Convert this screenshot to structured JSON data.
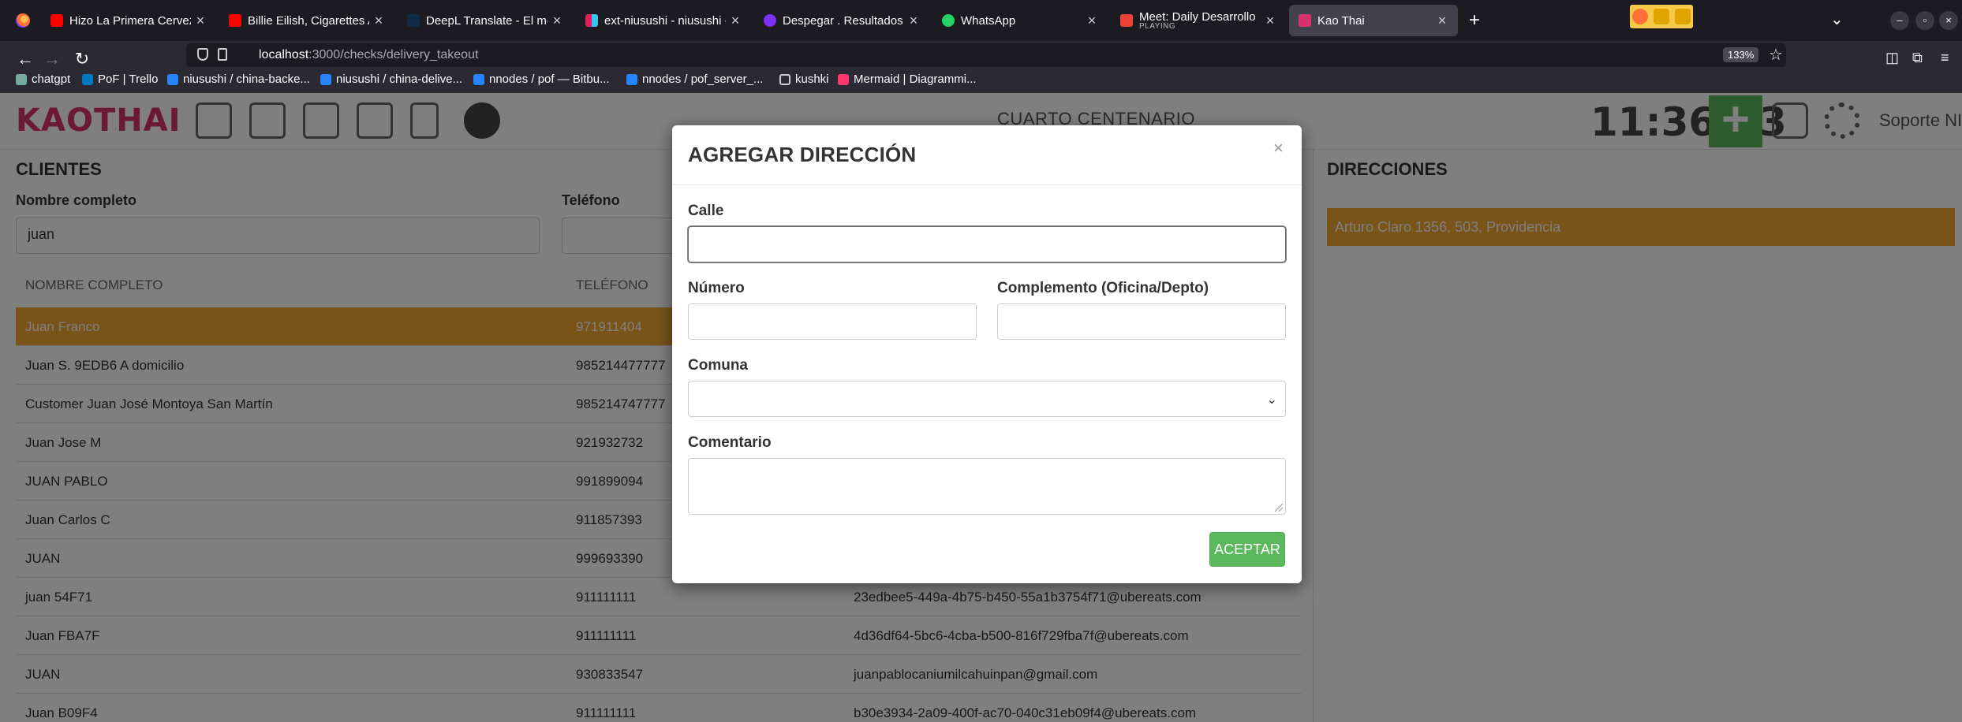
{
  "browser": {
    "tabs": [
      {
        "title": "Hizo La Primera Cerveza C",
        "icon": "youtube-icon"
      },
      {
        "title": "Billie Eilish, Cigarettes Af",
        "icon": "youtube-icon"
      },
      {
        "title": "DeepL Translate - El mejo",
        "icon": "deepl-icon"
      },
      {
        "title": "ext-niusushi - niusushi - Sl",
        "icon": "slack-icon"
      },
      {
        "title": "Despegar . Resultados de",
        "icon": "despegar-icon"
      },
      {
        "title": "WhatsApp",
        "icon": "whatsapp-icon"
      },
      {
        "title": "Meet: Daily Desarrollo",
        "subtitle": "PLAYING",
        "icon": "meet-icon"
      },
      {
        "title": "Kao Thai",
        "icon": "kaothai-icon",
        "active": true
      }
    ],
    "url_host": "localhost",
    "url_path": ":3000/checks/delivery_takeout",
    "zoom": "133%",
    "bookmarks": [
      "chatgpt",
      "PoF | Trello",
      "niusushi / china-backe...",
      "niusushi / china-delive...",
      "nnodes / pof — Bitbu...",
      "nnodes / pof_server_...",
      "kushki",
      "Mermaid | Diagrammi..."
    ]
  },
  "app": {
    "logo": "KAOTHAI",
    "location": "CUARTO CENTENARIO",
    "clock": "11:36:33",
    "user": "Soporte NIU -",
    "colors": {
      "accent": "#f0a830",
      "success": "#5cb85c",
      "brand": "#d6336c"
    }
  },
  "clients": {
    "title": "CLIENTES",
    "name_label": "Nombre completo",
    "name_value": "juan",
    "phone_label": "Teléfono",
    "columns": [
      "NOMBRE COMPLETO",
      "TELÉFONO"
    ],
    "rows": [
      {
        "name": "Juan Franco",
        "phone": "971911404",
        "email": "",
        "selected": true
      },
      {
        "name": "Juan S. 9EDB6 A domicilio",
        "phone": "985214477777",
        "email": ""
      },
      {
        "name": "Customer Juan José Montoya San Martín",
        "phone": "985214747777",
        "email": ""
      },
      {
        "name": "Juan Jose M",
        "phone": "921932732",
        "email": ""
      },
      {
        "name": "JUAN PABLO",
        "phone": "991899094",
        "email": ""
      },
      {
        "name": "Juan Carlos C",
        "phone": "911857393",
        "email": ""
      },
      {
        "name": "JUAN",
        "phone": "999693390",
        "email": ""
      },
      {
        "name": "juan 54F71",
        "phone": "911111111",
        "email": "23edbee5-449a-4b75-b450-55a1b3754f71@ubereats.com"
      },
      {
        "name": "Juan FBA7F",
        "phone": "911111111",
        "email": "4d36df64-5bc6-4cba-b500-816f729fba7f@ubereats.com"
      },
      {
        "name": "JUAN",
        "phone": "930833547",
        "email": "juanpablocaniumilcahuinpan@gmail.com"
      },
      {
        "name": "Juan B09F4",
        "phone": "911111111",
        "email": "b30e3934-2a09-400f-ac70-040c31eb09f4@ubereats.com"
      }
    ]
  },
  "addresses": {
    "title": "DIRECCIONES",
    "items": [
      "Arturo Claro 1356, 503, Providencia"
    ]
  },
  "modal": {
    "title": "AGREGAR DIRECCIÓN",
    "close": "×",
    "street_label": "Calle",
    "street_value": "",
    "number_label": "Número",
    "number_value": "",
    "complement_label": "Complemento (Oficina/Depto)",
    "complement_value": "",
    "commune_label": "Comuna",
    "commune_value": "",
    "comment_label": "Comentario",
    "comment_value": "",
    "accept_label": "ACEPTAR"
  }
}
